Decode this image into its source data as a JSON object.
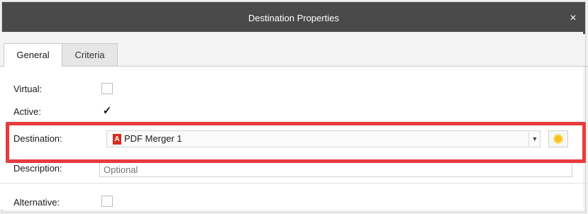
{
  "dialog": {
    "title": "Destination Properties",
    "close_glyph": "×"
  },
  "tabs": [
    {
      "label": "General",
      "active": true
    },
    {
      "label": "Criteria",
      "active": false
    }
  ],
  "fields": {
    "virtual": {
      "label": "Virtual:",
      "checked": false
    },
    "active": {
      "label": "Active:",
      "checked": true,
      "check_glyph": "✓"
    },
    "destination": {
      "label": "Destination:",
      "value": "PDF Merger 1",
      "icon": "pdf-icon",
      "icon_glyph": "A",
      "dropdown_glyph": "▼",
      "settings_icon": "gear-icon"
    },
    "description": {
      "label": "Description:",
      "placeholder": "Optional",
      "value": ""
    },
    "alternative": {
      "label": "Alternative:",
      "checked": false
    }
  },
  "colors": {
    "titlebar": "#4a4a4a",
    "highlight": "#e73b3f",
    "pdf_icon": "#d82b20",
    "settings_icon": "#f4c21a"
  }
}
